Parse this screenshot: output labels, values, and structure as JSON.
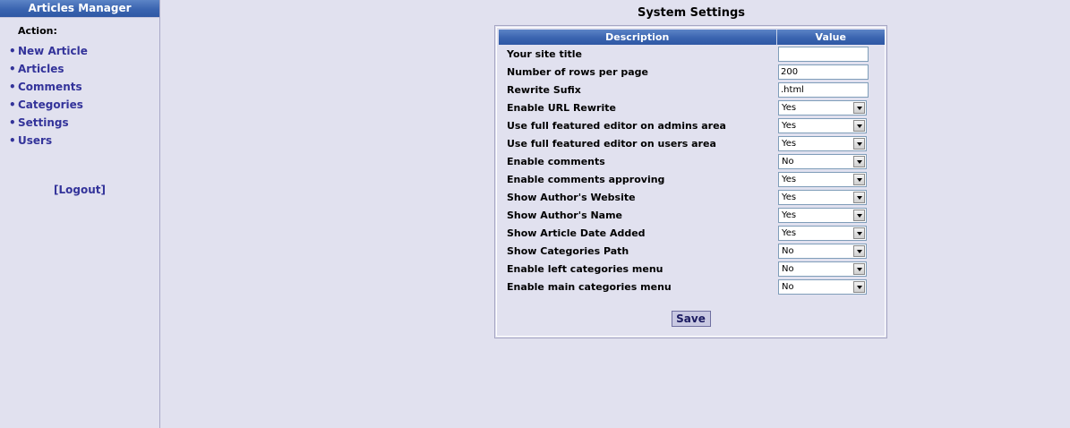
{
  "sidebar": {
    "title": "Articles Manager",
    "action_label": "Action:",
    "bullet": "•",
    "items": [
      {
        "label": "New Article"
      },
      {
        "label": "Articles"
      },
      {
        "label": "Comments"
      },
      {
        "label": "Categories"
      },
      {
        "label": "Settings"
      },
      {
        "label": "Users"
      }
    ],
    "logout_label": "[Logout]"
  },
  "main": {
    "title": "System Settings",
    "table": {
      "headers": {
        "description": "Description",
        "value": "Value"
      },
      "rows": [
        {
          "label": "Your site title",
          "type": "text",
          "value": ""
        },
        {
          "label": "Number of rows per page",
          "type": "text",
          "value": "200"
        },
        {
          "label": "Rewrite Sufix",
          "type": "text",
          "value": ".html"
        },
        {
          "label": "Enable URL Rewrite",
          "type": "select",
          "value": "Yes"
        },
        {
          "label": "Use full featured editor on admins area",
          "type": "select",
          "value": "Yes"
        },
        {
          "label": "Use full featured editor on users area",
          "type": "select",
          "value": "Yes"
        },
        {
          "label": "Enable comments",
          "type": "select",
          "value": "No"
        },
        {
          "label": "Enable comments approving",
          "type": "select",
          "value": "Yes"
        },
        {
          "label": "Show Author's Website",
          "type": "select",
          "value": "Yes"
        },
        {
          "label": "Show Author's Name",
          "type": "select",
          "value": "Yes"
        },
        {
          "label": "Show Article Date Added",
          "type": "select",
          "value": "Yes"
        },
        {
          "label": "Show Categories Path",
          "type": "select",
          "value": "No"
        },
        {
          "label": "Enable left categories menu",
          "type": "select",
          "value": "No"
        },
        {
          "label": "Enable main categories menu",
          "type": "select",
          "value": "No"
        }
      ]
    },
    "save_label": "Save"
  },
  "colors": {
    "background": "#e1e1ef",
    "header_blue": "#3a64b0",
    "link": "#33339a"
  }
}
